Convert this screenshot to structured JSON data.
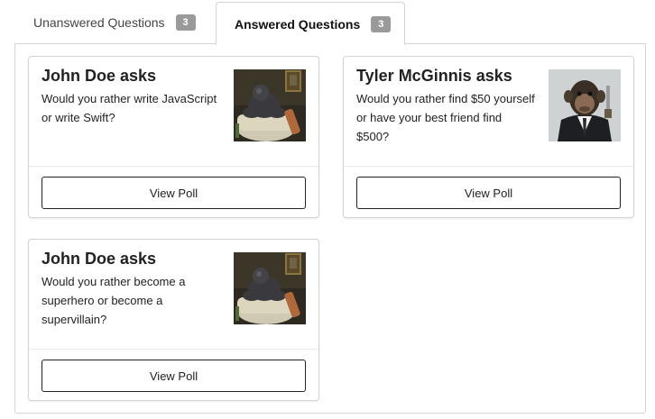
{
  "tabs": [
    {
      "label": "Unanswered Questions",
      "count": "3",
      "active": false
    },
    {
      "label": "Answered Questions",
      "count": "3",
      "active": true
    }
  ],
  "cards": [
    {
      "title": "John Doe asks",
      "question": "Would you rather write JavaScript or write Swift?",
      "button": "View Poll",
      "avatar": "gorilla-in-bathtub-image"
    },
    {
      "title": "Tyler McGinnis asks",
      "question": "Would you rather find $50 yourself or have your best friend find $500?",
      "button": "View Poll",
      "avatar": "chimp-in-suit-image"
    },
    {
      "title": "John Doe asks",
      "question": "Would you rather become a superhero or become a supervillain?",
      "button": "View Poll",
      "avatar": "gorilla-in-bathtub-image"
    }
  ],
  "colors": {
    "border": "#d4d4d5",
    "badge": "#9a9a9a",
    "button_border": "#222222"
  }
}
